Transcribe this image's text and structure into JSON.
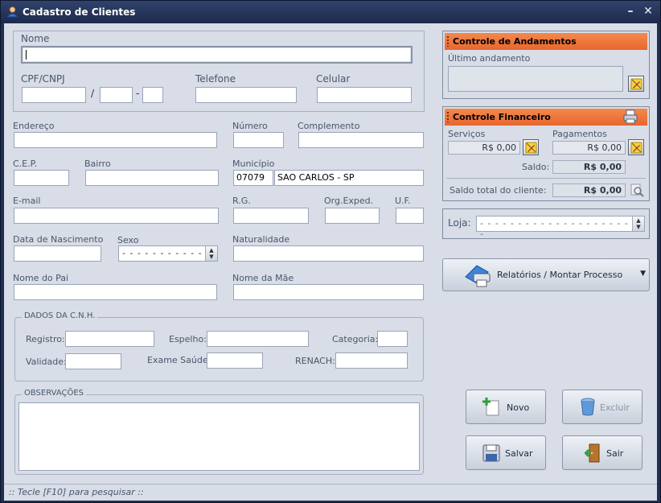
{
  "window": {
    "title": "Cadastro de Clientes",
    "minimize": "–",
    "close": "✕"
  },
  "form": {
    "nome_label": "Nome",
    "cpf_label": "CPF/CNPJ",
    "cpf_sep1": "/",
    "cpf_sep2": "-",
    "telefone_label": "Telefone",
    "celular_label": "Celular",
    "endereco_label": "Endereço",
    "numero_label": "Número",
    "complemento_label": "Complemento",
    "cep_label": "C.E.P.",
    "bairro_label": "Bairro",
    "municipio_label": "Município",
    "municipio_code": "07079",
    "municipio_name": "SAO CARLOS - SP",
    "email_label": "E-mail",
    "rg_label": "R.G.",
    "orgexped_label": "Org.Exped.",
    "uf_label": "U.F.",
    "nascimento_label": "Data de Nascimento",
    "sexo_label": "Sexo",
    "sexo_value": "- - - - - - - - - - -",
    "naturalidade_label": "Naturalidade",
    "pai_label": "Nome do Pai",
    "mae_label": "Nome da Mãe"
  },
  "cnh": {
    "title": "DADOS DA C.N.H.",
    "registro_label": "Registro:",
    "espelho_label": "Espelho:",
    "categoria_label": "Categoria:",
    "validade_label": "Validade:",
    "exame_label": "Exame Saúde:",
    "renach_label": "RENACH:"
  },
  "observacoes": {
    "title": "OBSERVAÇÕES"
  },
  "andamentos": {
    "title": "Controle de Andamentos",
    "ultimo_label": "Último andamento"
  },
  "financeiro": {
    "title": "Controle Financeiro",
    "servicos_label": "Serviços",
    "servicos_value": "R$ 0,00",
    "pagamentos_label": "Pagamentos",
    "pagamentos_value": "R$ 0,00",
    "saldo_label": "Saldo:",
    "saldo_value": "R$ 0,00",
    "saldo_total_label": "Saldo total do cliente:",
    "saldo_total_value": "R$ 0,00"
  },
  "loja": {
    "label": "Loja:",
    "value": "- - - - - - - - - - - - - - - - - - - - - -"
  },
  "relatorios_button": {
    "label": "Relatórios / Montar Processo"
  },
  "buttons": {
    "novo": "Novo",
    "excluir": "Excluir",
    "salvar": "Salvar",
    "sair": "Sair"
  },
  "status": {
    "text": ":: Tecle [F10] para pesquisar ::"
  },
  "colors": {
    "accent": "#e8662e",
    "frame": "#1f2e52",
    "client_bg": "#d8dde7"
  }
}
